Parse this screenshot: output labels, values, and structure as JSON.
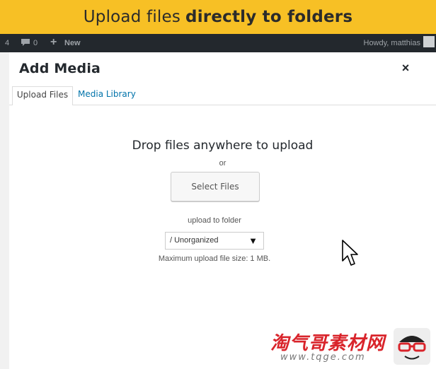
{
  "banner": {
    "lead": "Upload files",
    "emphasis": "directly to folders"
  },
  "admin_bar": {
    "count": "4",
    "comments": "0",
    "new_label": "New",
    "greeting": "Howdy, matthias"
  },
  "modal": {
    "title": "Add Media",
    "close_glyph": "×",
    "tabs": [
      {
        "label": "Upload Files",
        "active": true
      },
      {
        "label": "Media Library",
        "active": false
      }
    ],
    "drop_text": "Drop files anywhere to upload",
    "or_text": "or",
    "select_files_label": "Select Files",
    "upload_to_folder_label": "upload to folder",
    "folder_select": {
      "value": "/ Unorganized",
      "arrow": "▼"
    },
    "max_upload": "Maximum upload file size: 1 MB."
  },
  "watermark": {
    "text": "淘气哥素材网",
    "url": "www.tqge.com"
  },
  "colors": {
    "banner": "#f7c025",
    "admin_bar": "#23282d",
    "link": "#0073aa",
    "watermark": "#d9242b"
  },
  "icons": {
    "comment": "comment-icon",
    "plus": "plus-icon",
    "close": "close-icon",
    "cursor": "mouse-pointer-icon",
    "dropdown": "triangle-down-icon"
  }
}
